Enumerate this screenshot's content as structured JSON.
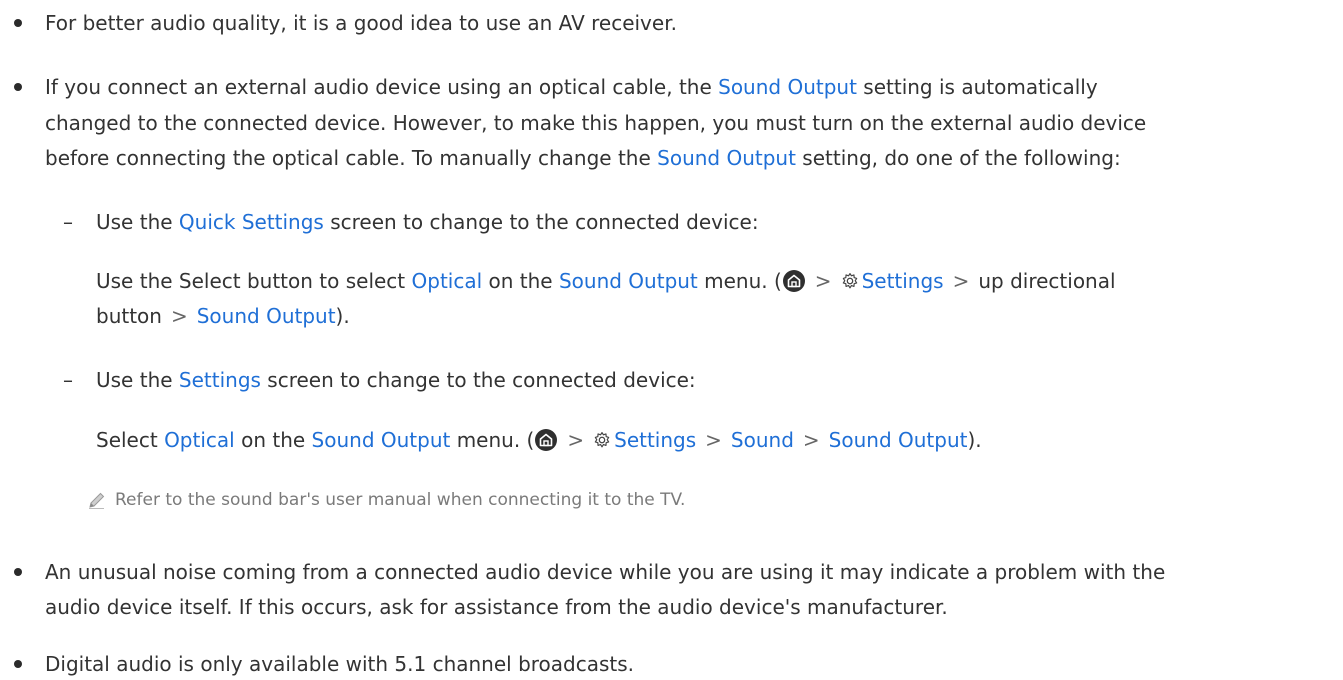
{
  "bullets": [
    {
      "text": "For better audio quality, it is a good idea to use an AV receiver."
    },
    {
      "line1_a": "If you connect an external audio device using an optical cable, the ",
      "line1_hl": "Sound Output",
      "line1_b": " setting is automatically",
      "line2": "changed to the connected device. However, to make this happen, you must turn on the external audio device",
      "line3_a": "before connecting the optical cable. To manually change the ",
      "line3_hl": "Sound Output",
      "line3_b": " setting, do one of the following:"
    },
    {
      "line1": "An unusual noise coming from a connected audio device while you are using it may indicate a problem with the",
      "line2": "audio device itself. If this occurs, ask for assistance from the audio device's manufacturer."
    },
    {
      "text": "Digital audio is only available with 5.1 channel broadcasts."
    }
  ],
  "sub_items": [
    {
      "dash": "–",
      "intro_a": "Use the ",
      "intro_hl": "Quick Settings",
      "intro_b": " screen to change to the connected device:",
      "detail1_a": "Use the Select button to select ",
      "detail1_hl1": "Optical",
      "detail1_b": " on the ",
      "detail1_hl2": "Sound Output",
      "detail1_c": " menu. (",
      "detail1_arrow1": ">",
      "detail1_settings": "Settings",
      "detail1_arrow2": ">",
      "detail1_d": "up directional",
      "detail2_a": "button",
      "detail2_arrow": ">",
      "detail2_hl": "Sound Output",
      "detail2_b": ")."
    },
    {
      "dash": "–",
      "intro_a": "Use the ",
      "intro_hl": "Settings",
      "intro_b": " screen to change to the connected device:",
      "detail1_a": "Select ",
      "detail1_hl1": "Optical",
      "detail1_b": " on the ",
      "detail1_hl2": "Sound Output",
      "detail1_c": " menu. (",
      "detail1_arrow1": ">",
      "detail1_settings": "Settings",
      "detail1_arrow2": ">",
      "detail1_sound": "Sound",
      "detail1_arrow3": ">",
      "detail1_hl3": "Sound Output",
      "detail1_d": ")."
    }
  ],
  "note": "Refer to the sound bar's user manual when connecting it to the TV.",
  "colors": {
    "highlight": "#1f6fd6",
    "text": "#333333",
    "note": "#7a7a7a"
  },
  "icons": [
    "home-icon",
    "gear-icon",
    "pencil-icon"
  ]
}
